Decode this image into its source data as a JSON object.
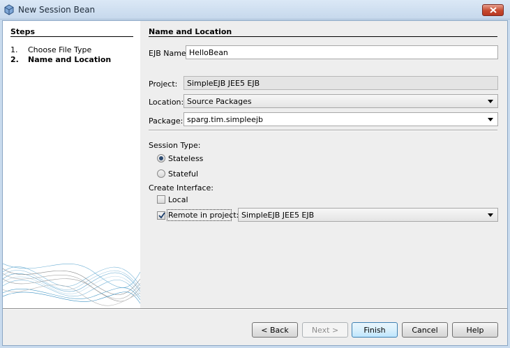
{
  "window": {
    "title": "New Session Bean"
  },
  "steps": {
    "title": "Steps",
    "items": [
      {
        "number": "1.",
        "label": "Choose File Type"
      },
      {
        "number": "2.",
        "label": "Name and Location"
      }
    ]
  },
  "form": {
    "section_title": "Name and Location",
    "ejb_name": {
      "label": "EJB Name:",
      "value": "HelloBean"
    },
    "project": {
      "label": "Project:",
      "value": "SimpleEJB JEE5 EJB"
    },
    "location": {
      "label": "Location:",
      "value": "Source Packages"
    },
    "package": {
      "label": "Package:",
      "value": "sparg.tim.simpleejb"
    },
    "session_type": {
      "label": "Session Type:",
      "options": [
        {
          "label": "Stateless",
          "selected": true
        },
        {
          "label": "Stateful",
          "selected": false
        }
      ]
    },
    "create_interface": {
      "label": "Create Interface:",
      "local": {
        "label": "Local",
        "checked": false
      },
      "remote": {
        "label": "Remote in project:",
        "checked": true,
        "project": "SimpleEJB JEE5 EJB"
      }
    }
  },
  "buttons": {
    "back": "< Back",
    "next": "Next >",
    "finish": "Finish",
    "cancel": "Cancel",
    "help": "Help"
  }
}
